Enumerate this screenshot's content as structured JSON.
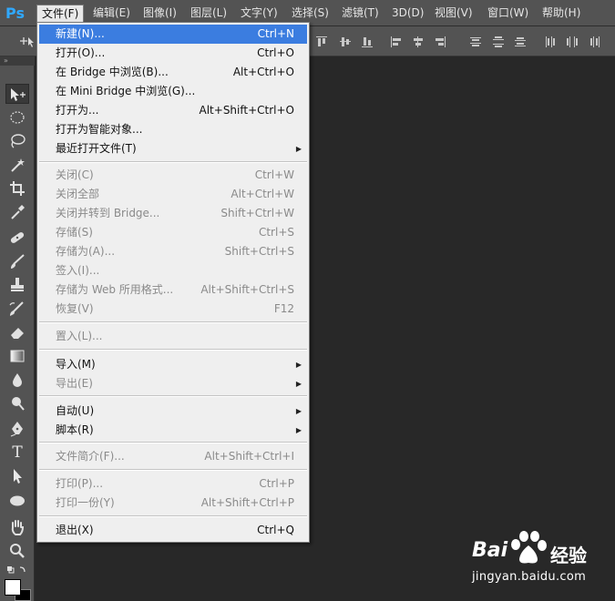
{
  "app": {
    "logo": "Ps"
  },
  "menubar": {
    "items": [
      {
        "label": "文件(F)",
        "open": true
      },
      {
        "label": "编辑(E)"
      },
      {
        "label": "图像(I)"
      },
      {
        "label": "图层(L)"
      },
      {
        "label": "文字(Y)"
      },
      {
        "label": "选择(S)"
      },
      {
        "label": "滤镜(T)"
      },
      {
        "label": "3D(D)"
      },
      {
        "label": "视图(V)"
      },
      {
        "label": "窗口(W)"
      },
      {
        "label": "帮助(H)"
      }
    ]
  },
  "file_menu": {
    "items": [
      {
        "label": "新建(N)...",
        "shortcut": "Ctrl+N",
        "highlighted": true
      },
      {
        "label": "打开(O)...",
        "shortcut": "Ctrl+O"
      },
      {
        "label": "在 Bridge 中浏览(B)...",
        "shortcut": "Alt+Ctrl+O"
      },
      {
        "label": "在 Mini Bridge 中浏览(G)...",
        "shortcut": ""
      },
      {
        "label": "打开为...",
        "shortcut": "Alt+Shift+Ctrl+O"
      },
      {
        "label": "打开为智能对象...",
        "shortcut": ""
      },
      {
        "label": "最近打开文件(T)",
        "shortcut": "",
        "submenu": true
      },
      {
        "label": "关闭(C)",
        "shortcut": "Ctrl+W",
        "disabled": true
      },
      {
        "label": "关闭全部",
        "shortcut": "Alt+Ctrl+W",
        "disabled": true
      },
      {
        "label": "关闭并转到 Bridge...",
        "shortcut": "Shift+Ctrl+W",
        "disabled": true
      },
      {
        "label": "存储(S)",
        "shortcut": "Ctrl+S",
        "disabled": true
      },
      {
        "label": "存储为(A)...",
        "shortcut": "Shift+Ctrl+S",
        "disabled": true
      },
      {
        "label": "签入(I)...",
        "shortcut": "",
        "disabled": true
      },
      {
        "label": "存储为 Web 所用格式...",
        "shortcut": "Alt+Shift+Ctrl+S",
        "disabled": true
      },
      {
        "label": "恢复(V)",
        "shortcut": "F12",
        "disabled": true
      },
      {
        "label": "置入(L)...",
        "shortcut": "",
        "disabled": true
      },
      {
        "label": "导入(M)",
        "shortcut": "",
        "submenu": true
      },
      {
        "label": "导出(E)",
        "shortcut": "",
        "submenu": true,
        "disabled": true
      },
      {
        "label": "自动(U)",
        "shortcut": "",
        "submenu": true
      },
      {
        "label": "脚本(R)",
        "shortcut": "",
        "submenu": true
      },
      {
        "label": "文件简介(F)...",
        "shortcut": "Alt+Shift+Ctrl+I",
        "disabled": true
      },
      {
        "label": "打印(P)...",
        "shortcut": "Ctrl+P",
        "disabled": true
      },
      {
        "label": "打印一份(Y)",
        "shortcut": "Alt+Shift+Ctrl+P",
        "disabled": true
      },
      {
        "label": "退出(X)",
        "shortcut": "Ctrl+Q"
      }
    ],
    "submenu_arrow": "▶"
  },
  "toolbar": {
    "tools": [
      "move-tool-icon",
      "marquee-tool-icon",
      "lasso-tool-icon",
      "magic-wand-tool-icon",
      "crop-tool-icon",
      "eyedropper-tool-icon",
      "healing-brush-tool-icon",
      "brush-tool-icon",
      "clone-stamp-tool-icon",
      "history-brush-tool-icon",
      "eraser-tool-icon",
      "gradient-tool-icon",
      "blur-tool-icon",
      "dodge-tool-icon",
      "pen-tool-icon",
      "type-tool-icon",
      "path-selection-tool-icon",
      "ellipse-tool-icon",
      "hand-tool-icon",
      "zoom-tool-icon"
    ],
    "type_tool_glyph": "T"
  },
  "watermark": {
    "brand": "Bai",
    "brand_cn": "经验",
    "url": "jingyan.baidu.com"
  },
  "colors": {
    "accent": "#3b7de0",
    "menubar": "#535353",
    "canvas": "#282828",
    "menu_bg": "#efefef",
    "ps_blue": "#30a8ff"
  }
}
